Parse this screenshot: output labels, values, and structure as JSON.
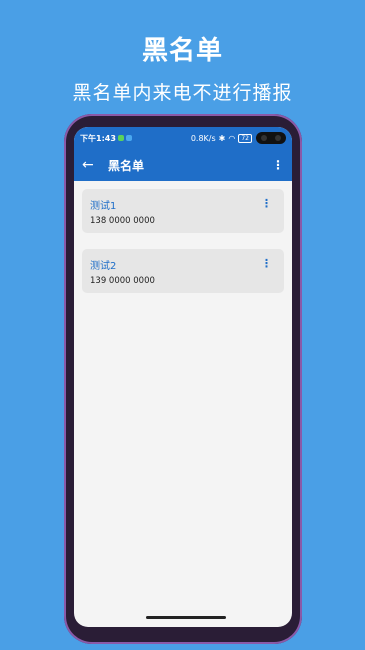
{
  "promo": {
    "title": "黑名单",
    "subtitle": "黑名单内来电不进行播报"
  },
  "status_bar": {
    "time": "下午1:43",
    "speed": "0.8K/s",
    "battery": "72"
  },
  "app_bar": {
    "back_icon": "←",
    "title": "黑名单",
    "more_icon": "⋮"
  },
  "contacts": [
    {
      "name": "测试1",
      "phone": "138 0000 0000"
    },
    {
      "name": "测试2",
      "phone": "139 0000 0000"
    }
  ],
  "colors": {
    "background": "#4a9fe6",
    "primary": "#1f6ec8",
    "card": "#e6e6e6"
  }
}
